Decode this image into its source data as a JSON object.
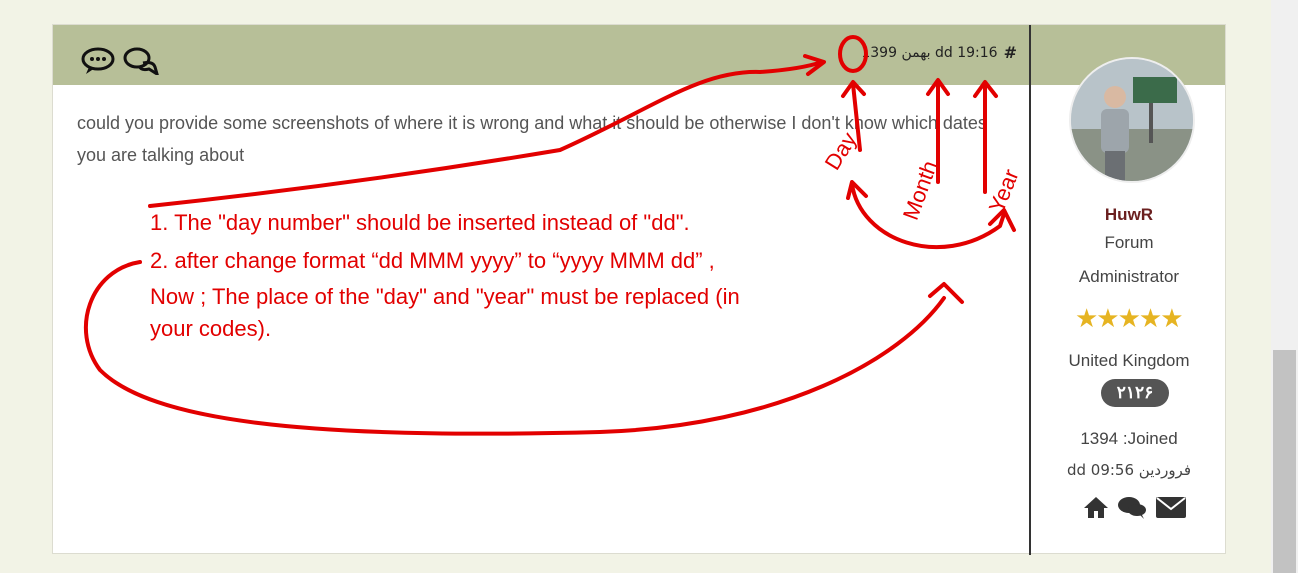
{
  "post": {
    "meta": {
      "hash": "#",
      "date_text": "1399 بهمن dd 19:16"
    },
    "body": "could you provide some screenshots of where it is wrong and what it should be otherwise I don't know which dates you are talking about"
  },
  "user": {
    "name": "HuwR",
    "role_line1": "Forum",
    "role_line2": "Administrator",
    "stars": "★★★★★",
    "country": "United Kingdom",
    "post_count": "۲۱۲۶",
    "joined": "1394 :Joined",
    "joined_date": "dd 09:56 فروردین"
  },
  "annotations": {
    "line1": "1. The \"day number\" should be inserted instead of \"dd\".",
    "line2": "2. after change format “dd MMM yyyy” to “yyyy MMM dd” ,",
    "line3": "Now ; The place of the \"day\" and \"year\" must be replaced (in",
    "line4": "your codes).",
    "label_day": "Day",
    "label_month": "Month",
    "label_year": "Year"
  },
  "colors": {
    "header_bg": "#b7bf98",
    "annotation": "#e20000",
    "username": "#6b2020",
    "stars": "#e6b422"
  }
}
